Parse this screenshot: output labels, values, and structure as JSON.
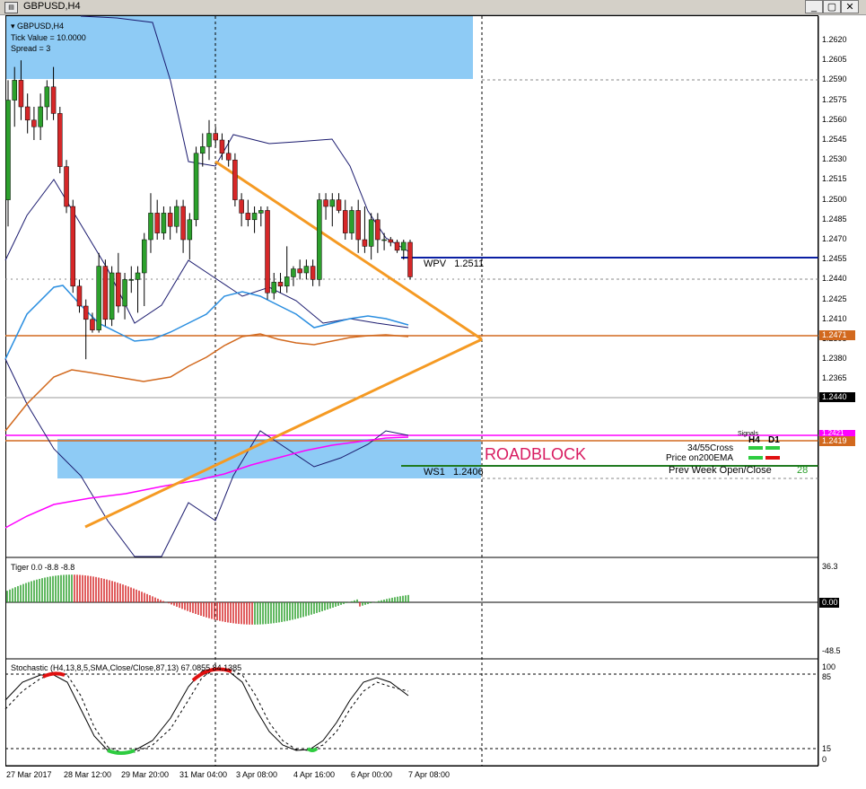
{
  "window": {
    "title": "GBPUSD,H4",
    "minimize": "_",
    "restore": "▢",
    "close": "✕"
  },
  "info": {
    "symbol": "GBPUSD,H4",
    "tick_value": "Tick Value = 10.0000",
    "spread": "Spread = 3"
  },
  "price_axis": [
    "1.2620",
    "1.2605",
    "1.2590",
    "1.2575",
    "1.2560",
    "1.2545",
    "1.2530",
    "1.2515",
    "1.2500",
    "1.2485",
    "1.2470",
    "1.2455",
    "1.2440",
    "1.2425",
    "1.2410",
    "1.2395",
    "1.2380",
    "1.2365"
  ],
  "price_tags": {
    "ma_level": "1.2471",
    "current": "1.2440",
    "magenta": "1.2421",
    "orange": "1.2419"
  },
  "levels": {
    "wpv_label": "WPV",
    "wpv_value": "1.2511",
    "ws1_label": "WS1",
    "ws1_value": "1.2406",
    "roadblock": "ROADBLOCK"
  },
  "signals": {
    "header": "Signals",
    "h4": "H4",
    "d1": "D1",
    "cross": "34/55Cross",
    "ema": "Price on200EMA",
    "prev_week": "Prev Week Open/Close",
    "prev_week_value": "28"
  },
  "tiger": {
    "label": "Tiger 0.0 -8.8 -8.8",
    "top": "36.3",
    "zero": "0.00",
    "bottom": "-48.5"
  },
  "stoch": {
    "label": "Stochastic (H4,13,8,5,SMA,Close/Close,87,13) 67.0855 84.1385",
    "scale": [
      "100",
      "85",
      "15",
      "0"
    ]
  },
  "time_axis": [
    "27 Mar 2017",
    "28 Mar 12:00",
    "29 Mar 20:00",
    "31 Mar 04:00",
    "3 Apr 08:00",
    "4 Apr 16:00",
    "6 Apr 00:00",
    "7 Apr 08:00"
  ],
  "colors": {
    "bull": "#2ca02c",
    "bear": "#d62728",
    "triangle": "#f59a23",
    "wpv": "#0a1fa3",
    "ws1": "#1f7a1f",
    "magenta": "#ff00ff",
    "ma_orange": "#d2691e",
    "blue_ma": "#2a8ee0",
    "zone": "#8ecbf5"
  },
  "candles": [
    [
      1.25,
      1.259,
      1.248,
      1.2575
    ],
    [
      1.2575,
      1.26,
      1.2555,
      1.259
    ],
    [
      1.259,
      1.2605,
      1.256,
      1.257
    ],
    [
      1.257,
      1.258,
      1.255,
      1.256
    ],
    [
      1.256,
      1.257,
      1.2545,
      1.2555
    ],
    [
      1.2555,
      1.258,
      1.2545,
      1.257
    ],
    [
      1.257,
      1.259,
      1.256,
      1.2585
    ],
    [
      1.2585,
      1.26,
      1.256,
      1.2565
    ],
    [
      1.2565,
      1.257,
      1.252,
      1.2525
    ],
    [
      1.2525,
      1.253,
      1.249,
      1.2495
    ],
    [
      1.2495,
      1.25,
      1.243,
      1.2435
    ],
    [
      1.2435,
      1.244,
      1.2415,
      1.242
    ],
    [
      1.242,
      1.2425,
      1.238,
      1.241
    ],
    [
      1.241,
      1.2415,
      1.24,
      1.2402
    ],
    [
      1.2402,
      1.246,
      1.24,
      1.245
    ],
    [
      1.245,
      1.2455,
      1.2405,
      1.241
    ],
    [
      1.241,
      1.245,
      1.2405,
      1.2445
    ],
    [
      1.2445,
      1.246,
      1.2415,
      1.242
    ],
    [
      1.242,
      1.2445,
      1.241,
      1.244
    ],
    [
      1.244,
      1.245,
      1.243,
      1.244
    ],
    [
      1.244,
      1.245,
      1.2415,
      1.2445
    ],
    [
      1.2445,
      1.2475,
      1.242,
      1.247
    ],
    [
      1.247,
      1.2505,
      1.246,
      1.249
    ],
    [
      1.249,
      1.25,
      1.247,
      1.2475
    ],
    [
      1.2475,
      1.2495,
      1.247,
      1.249
    ],
    [
      1.249,
      1.2495,
      1.247,
      1.248
    ],
    [
      1.248,
      1.25,
      1.2475,
      1.2495
    ],
    [
      1.2495,
      1.25,
      1.246,
      1.247
    ],
    [
      1.247,
      1.249,
      1.2455,
      1.2485
    ],
    [
      1.2485,
      1.254,
      1.248,
      1.2535
    ],
    [
      1.2535,
      1.255,
      1.2525,
      1.254
    ],
    [
      1.254,
      1.256,
      1.253,
      1.255
    ],
    [
      1.255,
      1.2555,
      1.254,
      1.2545
    ],
    [
      1.2545,
      1.255,
      1.253,
      1.2535
    ],
    [
      1.2535,
      1.2545,
      1.2525,
      1.253
    ],
    [
      1.253,
      1.2535,
      1.2495,
      1.25
    ],
    [
      1.25,
      1.2505,
      1.248,
      1.249
    ],
    [
      1.249,
      1.25,
      1.248,
      1.2485
    ],
    [
      1.2485,
      1.2495,
      1.2475,
      1.249
    ],
    [
      1.249,
      1.2495,
      1.248,
      1.2492
    ],
    [
      1.2492,
      1.2495,
      1.2425,
      1.243
    ],
    [
      1.243,
      1.2445,
      1.2425,
      1.2438
    ],
    [
      1.2438,
      1.2445,
      1.243,
      1.2435
    ],
    [
      1.2435,
      1.2465,
      1.243,
      1.2442
    ],
    [
      1.2442,
      1.245,
      1.2435,
      1.2448
    ],
    [
      1.2448,
      1.2455,
      1.244,
      1.2445
    ],
    [
      1.2445,
      1.2455,
      1.244,
      1.245
    ],
    [
      1.245,
      1.2455,
      1.2435,
      1.244
    ],
    [
      1.244,
      1.2505,
      1.2435,
      1.25
    ],
    [
      1.25,
      1.2505,
      1.2485,
      1.2495
    ],
    [
      1.2495,
      1.2505,
      1.248,
      1.25
    ],
    [
      1.25,
      1.2505,
      1.249,
      1.2492
    ],
    [
      1.2492,
      1.25,
      1.247,
      1.2475
    ],
    [
      1.2475,
      1.2495,
      1.247,
      1.2492
    ],
    [
      1.2492,
      1.25,
      1.246,
      1.247
    ],
    [
      1.247,
      1.2495,
      1.246,
      1.2465
    ],
    [
      1.2465,
      1.249,
      1.2455,
      1.2485
    ],
    [
      1.2485,
      1.249,
      1.246,
      1.247
    ],
    [
      1.247,
      1.2475,
      1.2462,
      1.247
    ],
    [
      1.247,
      1.2472,
      1.2465,
      1.2468
    ],
    [
      1.2468,
      1.247,
      1.246,
      1.2462
    ],
    [
      1.2462,
      1.247,
      1.2455,
      1.2468
    ],
    [
      1.2468,
      1.247,
      1.244,
      1.2442
    ]
  ]
}
